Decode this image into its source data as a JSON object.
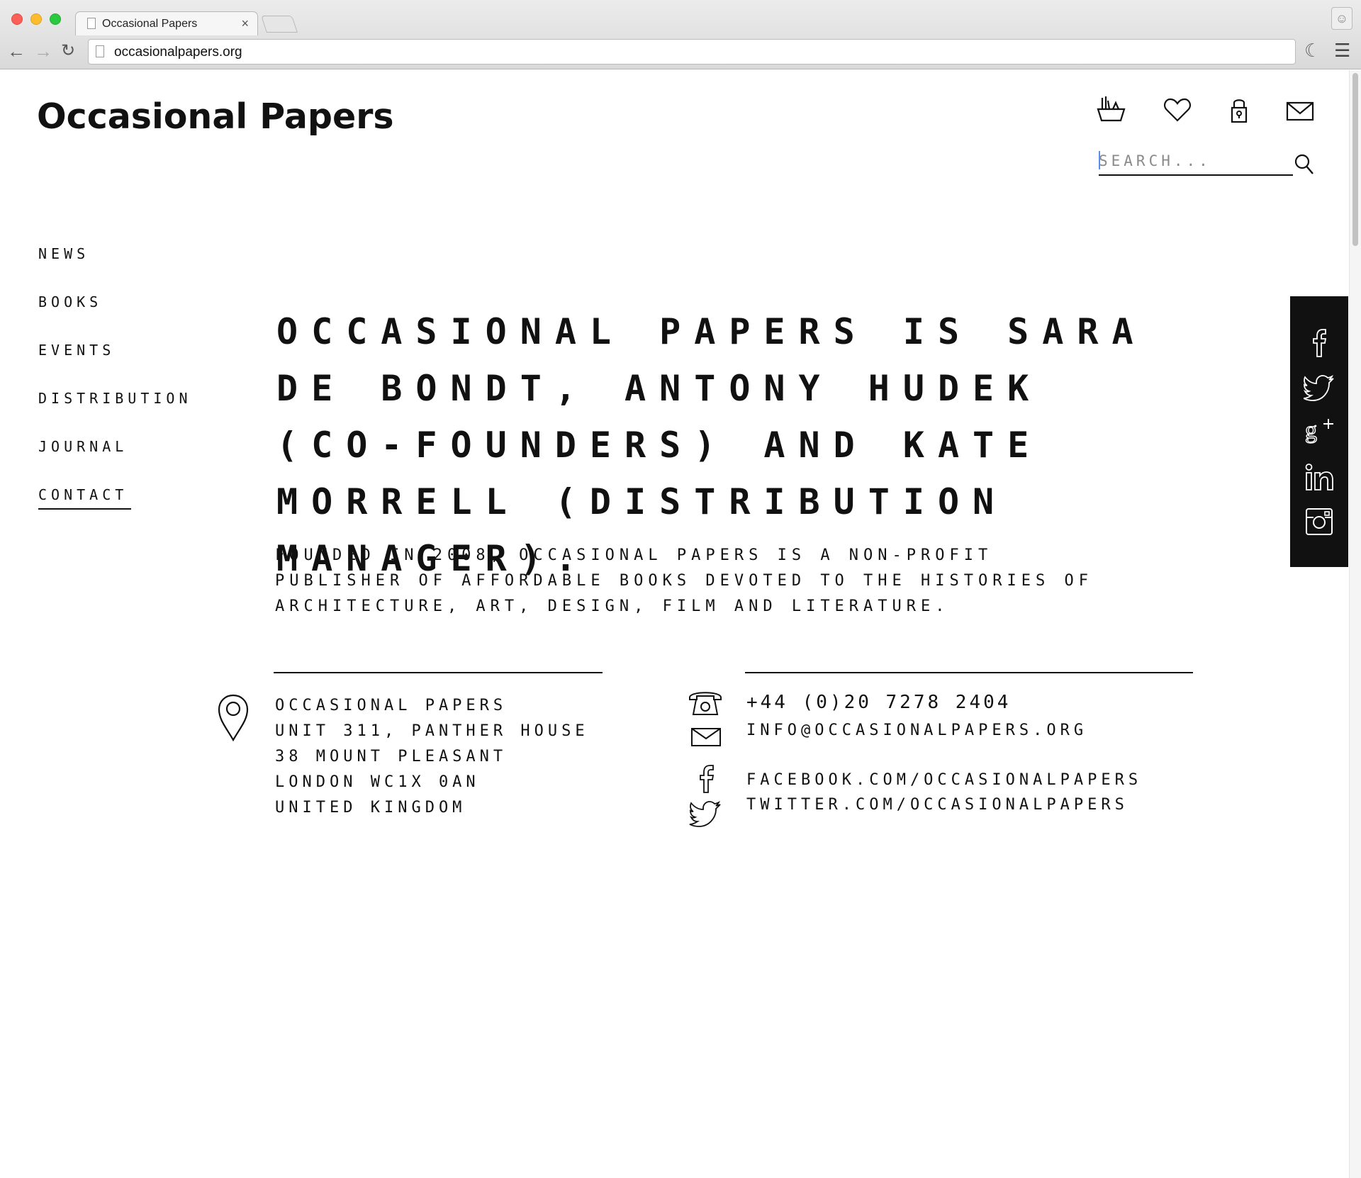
{
  "browser": {
    "tab_title": "Occasional Papers",
    "tab_close": "×",
    "url": "occasionalpapers.org"
  },
  "site": {
    "logo": "Occasional Papers",
    "search_placeholder": "SEARCH..."
  },
  "nav": {
    "items": [
      {
        "label": "NEWS"
      },
      {
        "label": "BOOKS"
      },
      {
        "label": "EVENTS"
      },
      {
        "label": "DISTRIBUTION"
      },
      {
        "label": "JOURNAL"
      },
      {
        "label": "CONTACT",
        "active": true
      }
    ]
  },
  "main": {
    "headline": "OCCASIONAL PAPERS IS SARA DE BONDT, ANTONY HUDEK (CO-FOUNDERS) AND KATE MORRELL (DISTRIBUTION MANAGER).",
    "intro": "FOUNDED IN 2008, OCCASIONAL PAPERS IS A NON-PROFIT PUBLISHER OF AFFORDABLE BOOKS DEVOTED TO THE HISTORIES OF ARCHITECTURE, ART, DESIGN, FILM AND LITERATURE."
  },
  "contact": {
    "address": [
      "OCCASIONAL PAPERS",
      "UNIT 311, PANTHER HOUSE",
      "38 MOUNT PLEASANT",
      "LONDON WC1X 0AN",
      "UNITED KINGDOM"
    ],
    "phone": "+44 (0)20 7278 2404",
    "email": "INFO@OCCASIONALPAPERS.ORG",
    "facebook": "FACEBOOK.COM/OCCASIONALPAPERS",
    "twitter": "TWITTER.COM/OCCASIONALPAPERS"
  },
  "icons": {
    "header": [
      "basket-icon",
      "heart-icon",
      "lock-icon",
      "mail-icon"
    ],
    "social": [
      "facebook-icon",
      "twitter-icon",
      "google-plus-icon",
      "linkedin-icon",
      "instagram-icon"
    ]
  },
  "colors": {
    "text": "#111111",
    "social_bar": "#111111",
    "background": "#ffffff"
  }
}
